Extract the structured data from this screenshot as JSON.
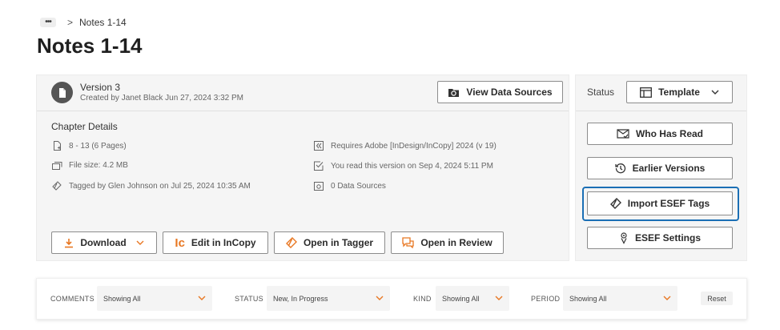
{
  "breadcrumb": {
    "more": "•••",
    "separator": ">",
    "current": "Notes 1-14"
  },
  "page_title": "Notes 1-14",
  "version": {
    "title": "Version 3",
    "subtitle": "Created by Janet Black Jun 27, 2024 3:32 PM",
    "view_sources_label": "View Data Sources"
  },
  "chapter": {
    "title": "Chapter Details",
    "pages": "8 - 13 (6 Pages)",
    "file_size": "File size: 4.2 MB",
    "tagged": "Tagged by Glen Johnson on Jul 25, 2024 10:35 AM",
    "requires": "Requires Adobe [InDesign/InCopy] 2024 (v 19)",
    "read": "You read this version on Sep 4, 2024 5:11 PM",
    "data_sources": "0 Data Sources"
  },
  "actions": {
    "download": "Download",
    "edit_incopy": "Edit in InCopy",
    "open_tagger": "Open in Tagger",
    "open_review": "Open in Review"
  },
  "side": {
    "status_label": "Status",
    "status_value": "Template",
    "who_has_read": "Who Has Read",
    "earlier_versions": "Earlier Versions",
    "import_esef": "Import ESEF Tags",
    "esef_settings": "ESEF Settings"
  },
  "filters": {
    "comments_label": "COMMENTS",
    "comments_value": "Showing All",
    "status_label": "STATUS",
    "status_value": "New, In Progress",
    "kind_label": "KIND",
    "kind_value": "Showing All",
    "period_label": "PERIOD",
    "period_value": "Showing All",
    "reset": "Reset"
  },
  "colors": {
    "accent": "#e87722",
    "focus": "#1b6fb5",
    "incopy": "#e87722"
  }
}
